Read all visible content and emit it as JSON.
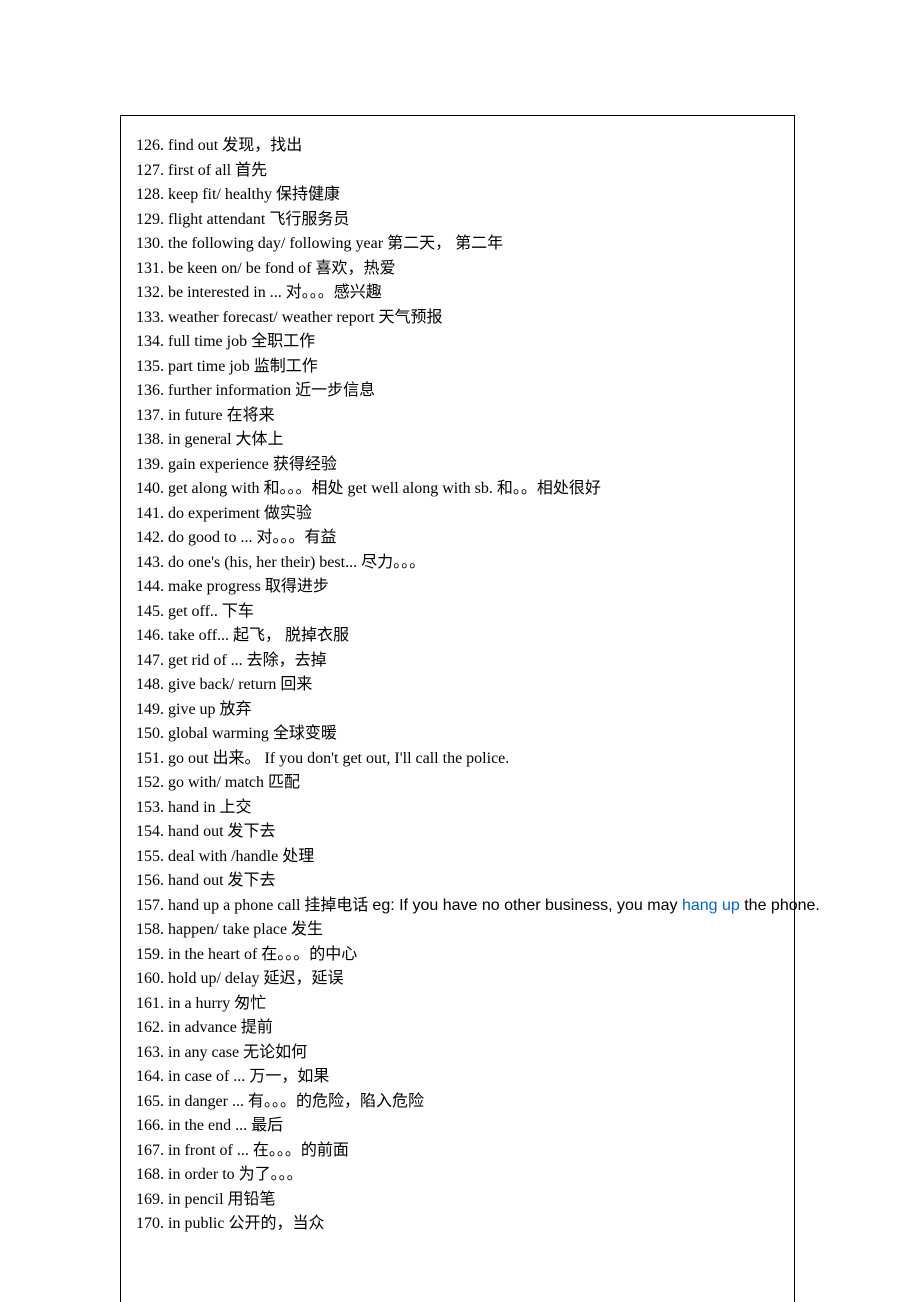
{
  "entries": [
    {
      "num": "126.",
      "phrase": "find out",
      "def": "发现，找出"
    },
    {
      "num": "127.",
      "phrase": "first of all",
      "def": "首先"
    },
    {
      "num": "128.",
      "phrase": "keep fit/ healthy",
      "def": "保持健康"
    },
    {
      "num": "129.",
      "phrase": "flight attendant",
      "def": "飞行服务员"
    },
    {
      "num": "130.",
      "phrase": "the following day/ following year",
      "def": "第二天， 第二年"
    },
    {
      "num": "131.",
      "phrase": "be keen on/ be fond of",
      "def": "喜欢，热爱"
    },
    {
      "num": "132.",
      "phrase": "be interested in ...",
      "def": "对。。。感兴趣"
    },
    {
      "num": "133.",
      "phrase": "weather forecast/ weather report",
      "def": "天气预报"
    },
    {
      "num": "134.",
      "phrase": "full time job",
      "def": "全职工作"
    },
    {
      "num": "135.",
      "phrase": "part time job",
      "def": "监制工作"
    },
    {
      "num": "136.",
      "phrase": "further information",
      "def": "近一步信息"
    },
    {
      "num": "137.",
      "phrase": "in future",
      "def": "在将来"
    },
    {
      "num": "138.",
      "phrase": "in general",
      "def": "大体上"
    },
    {
      "num": "139.",
      "phrase": "gain experience",
      "def": "获得经验"
    },
    {
      "num": "140.",
      "phrase": "get along with",
      "def": "和。。。相处 get well along with sb. 和。。相处很好"
    },
    {
      "num": "141.",
      "phrase": "do experiment",
      "def": "做实验"
    },
    {
      "num": "142.",
      "phrase": "do good to ...",
      "def": "对。。。有益"
    },
    {
      "num": "143.",
      "phrase": "do one's (his, her their) best...",
      "def": "尽力。。。"
    },
    {
      "num": "144.",
      "phrase": "make progress",
      "def": "取得进步"
    },
    {
      "num": "145.",
      "phrase": "get off..",
      "def": "下车"
    },
    {
      "num": "146.",
      "phrase": "take off...",
      "def": "起飞， 脱掉衣服"
    },
    {
      "num": "147.",
      "phrase": "get rid of ...",
      "def": "去除，去掉"
    },
    {
      "num": "148.",
      "phrase": "give back/ return",
      "def": "回来"
    },
    {
      "num": "149.",
      "phrase": "give up",
      "def": "放弃"
    },
    {
      "num": "150.",
      "phrase": "global warming",
      "def": "全球变暖"
    },
    {
      "num": "151.",
      "phrase": "go out",
      "def": "出来。 If you don't get out, I'll call the police."
    },
    {
      "num": "152.",
      "phrase": "go with/ match",
      "def": "匹配"
    },
    {
      "num": "153.",
      "phrase": "hand in",
      "def": "上交"
    },
    {
      "num": "154.",
      "phrase": "hand out",
      "def": "发下去"
    },
    {
      "num": "155.",
      "phrase": "deal with /handle",
      "def": "处理"
    },
    {
      "num": "156.",
      "phrase": "hand out",
      "def": "发下去"
    },
    {
      "num": "157.",
      "phrase": "hand up a phone call",
      "def_pre": "挂掉电话",
      "eg_pre": "eg: If you have no other business, you may ",
      "hl": "hang up",
      "eg_post": " the phone."
    },
    {
      "num": "158.",
      "phrase": "happen/ take place",
      "def": "发生"
    },
    {
      "num": "159.",
      "phrase": "in the heart of",
      "def": "在。。。的中心"
    },
    {
      "num": "160.",
      "phrase": "hold up/ delay",
      "def": "延迟，延误"
    },
    {
      "num": "161.",
      "phrase": "in a hurry",
      "def": "匆忙"
    },
    {
      "num": "162.",
      "phrase": "in advance",
      "def": "提前"
    },
    {
      "num": "163.",
      "phrase": "in any case",
      "def": "无论如何"
    },
    {
      "num": "164.",
      "phrase": "in case of ...",
      "def": "万一，如果"
    },
    {
      "num": "165.",
      "phrase": "in danger ...",
      "def": "有。。。的危险，陷入危险"
    },
    {
      "num": "166.",
      "phrase": "in the end ...",
      "def": "最后"
    },
    {
      "num": "167.",
      "phrase": "in front of ...",
      "def": "在。。。的前面"
    },
    {
      "num": "168.",
      "phrase": "in order to",
      "def": "为了。。。"
    },
    {
      "num": "169.",
      "phrase": "in pencil",
      "def": "用铅笔"
    },
    {
      "num": "170.",
      "phrase": "in public",
      "def": "公开的，当众"
    }
  ]
}
